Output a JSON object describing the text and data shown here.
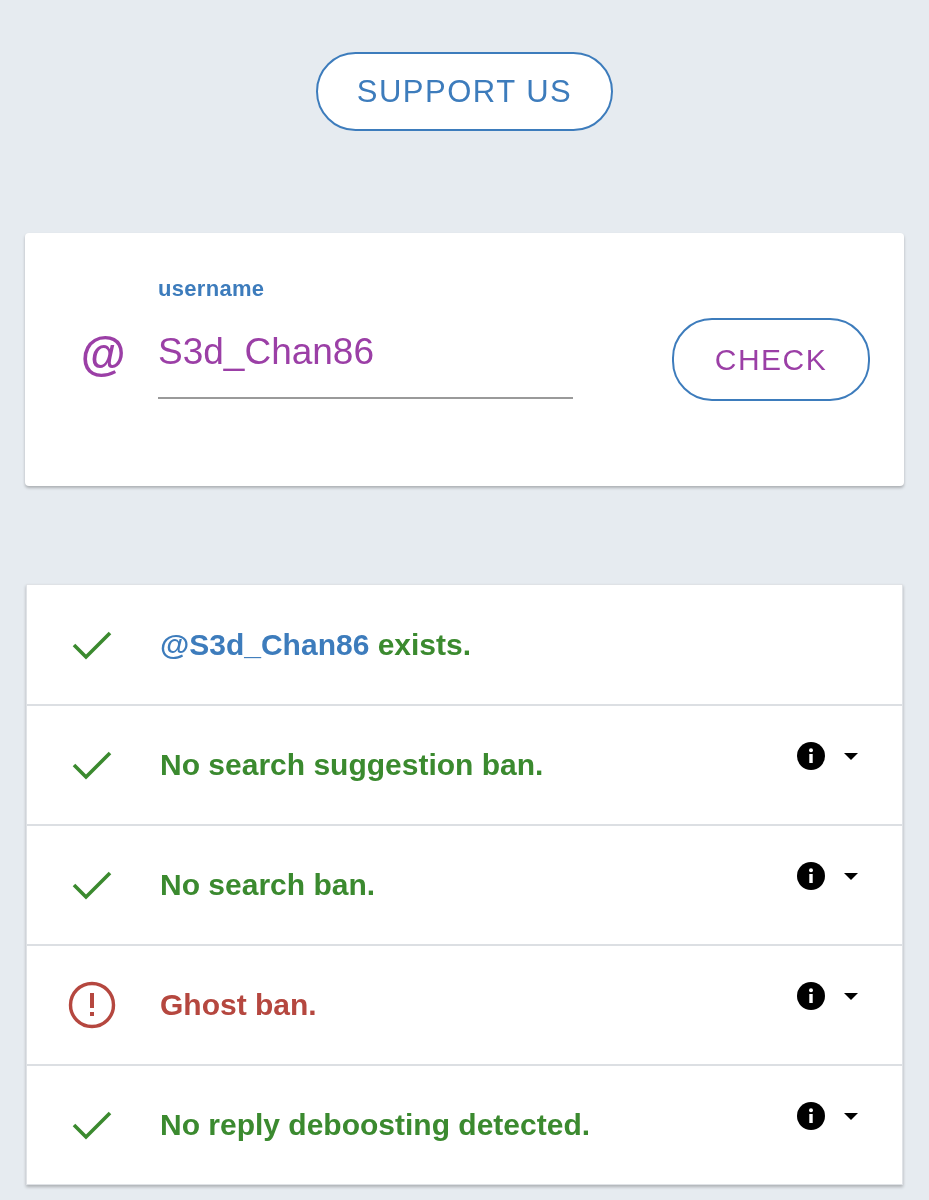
{
  "support_button": {
    "label": "SUPPORT US"
  },
  "search_card": {
    "prefix": "@",
    "field": {
      "label": "username",
      "value": "S3d_Chan86"
    },
    "check_button": {
      "label": "CHECK"
    }
  },
  "results": [
    {
      "kind": "account",
      "passed": true,
      "handle": "@S3d_Chan86",
      "text": "exists."
    },
    {
      "kind": "check",
      "passed": true,
      "text": "No search suggestion ban.",
      "expanded": false
    },
    {
      "kind": "check",
      "passed": true,
      "text": "No search ban.",
      "expanded": false
    },
    {
      "kind": "check",
      "passed": false,
      "text": "Ghost ban.",
      "expanded": false
    },
    {
      "kind": "check",
      "passed": true,
      "text": "No reply deboosting detected.",
      "expanded": false
    }
  ]
}
